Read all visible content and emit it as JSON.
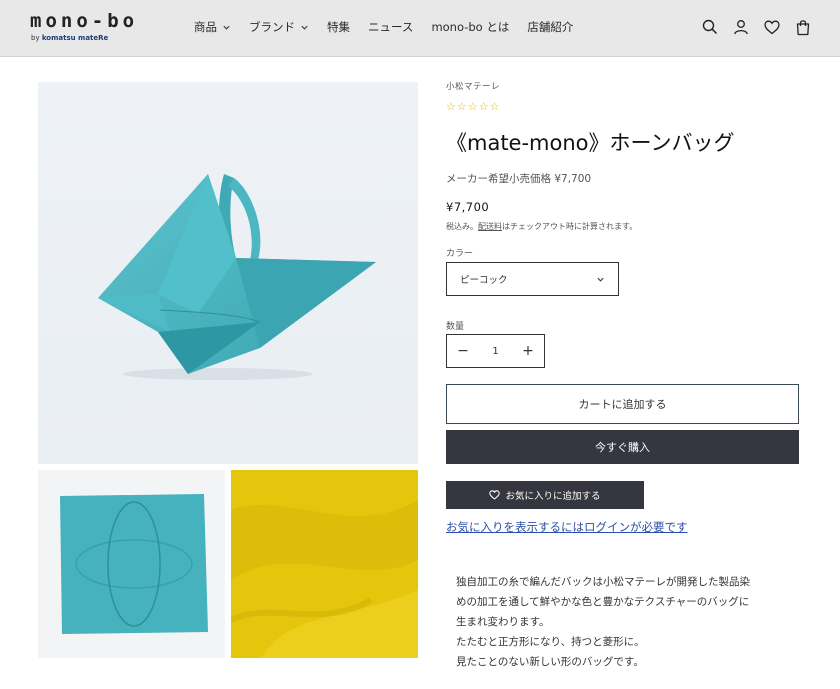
{
  "header": {
    "logo_main": "mono-bo",
    "logo_by": "by ",
    "logo_brand": "komatsu mateRe",
    "nav": [
      {
        "label": "商品",
        "dropdown": true
      },
      {
        "label": "ブランド",
        "dropdown": true
      },
      {
        "label": "特集",
        "dropdown": false
      },
      {
        "label": "ニュース",
        "dropdown": false
      },
      {
        "label": "mono-bo とは",
        "dropdown": false
      },
      {
        "label": "店舗紹介",
        "dropdown": false
      }
    ],
    "icons": [
      "search-icon",
      "account-icon",
      "heart-icon",
      "cart-icon"
    ]
  },
  "product": {
    "vendor": "小松マテーレ",
    "stars": "☆☆☆☆☆",
    "title": "《mate-mono》ホーンバッグ",
    "msrp": "メーカー希望小売価格 ¥7,700",
    "price": "¥7,700",
    "tax_prefix": "税込み。",
    "tax_link": "配送料",
    "tax_suffix": "はチェックアウト時に計算されます。",
    "color_label": "カラー",
    "color_value": "ピーコック",
    "qty_label": "数量",
    "qty_minus": "−",
    "qty_value": "1",
    "qty_plus": "+",
    "add_to_cart": "カートに追加する",
    "buy_now": "今すぐ購入",
    "add_favorite": "お気に入りに追加する",
    "favorite_login": "お気に入りを表示するにはログインが必要です",
    "description": [
      "独自加工の糸で編んだバックは小松マテーレが開発した製品染",
      "めの加工を通して鮮やかな色と豊かなテクスチャーのバッグに",
      "生まれ変わります。",
      "たたむと正方形になり、持つと菱形に。",
      "見たことのない新しい形のバッグです。"
    ]
  },
  "colors": {
    "header_bg": "#e8e8e8",
    "peacock": "#46b4bf",
    "yellow": "#e6c60c",
    "dark_button": "#35363f",
    "link": "#2c4fa8"
  }
}
